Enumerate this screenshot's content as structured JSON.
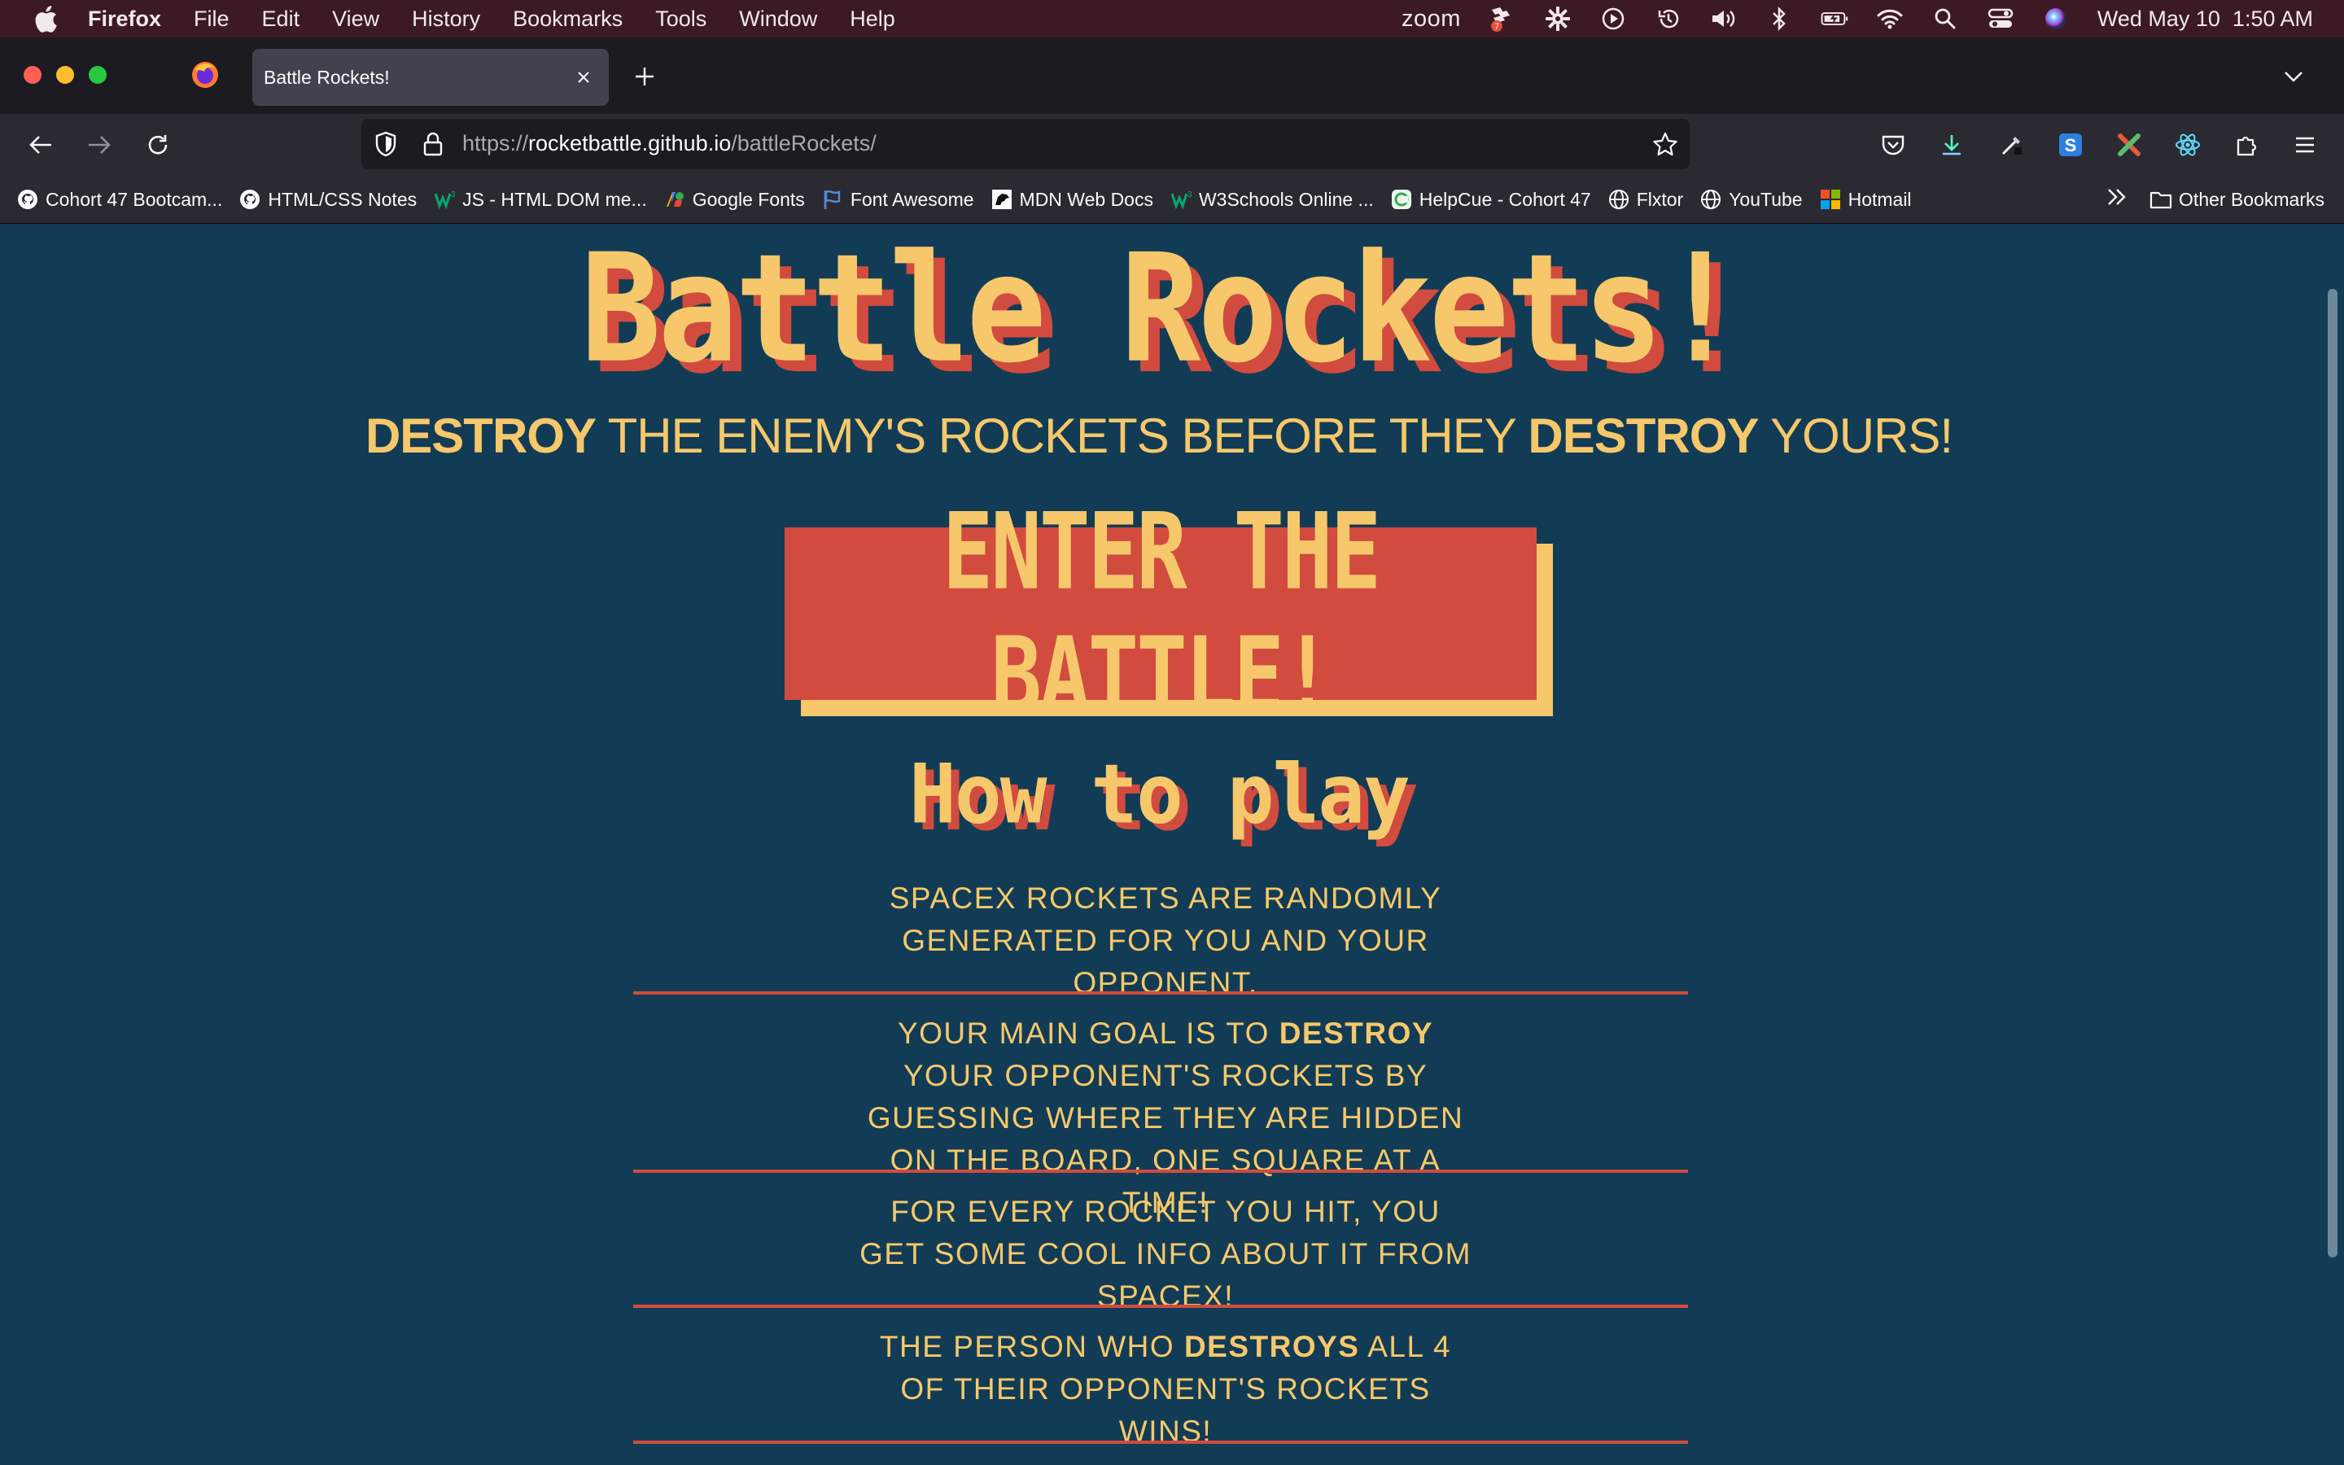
{
  "menubar": {
    "app_name": "Firefox",
    "menus": [
      "File",
      "Edit",
      "View",
      "History",
      "Bookmarks",
      "Tools",
      "Window",
      "Help"
    ],
    "zoom_label": "zoom",
    "badge_count": "7",
    "clock": "Wed May 10  1:50 AM",
    "status_icons": [
      "zoom",
      "flashcards-icon",
      "gear-icon",
      "play-icon",
      "time-machine-icon",
      "volume-icon",
      "bluetooth-icon",
      "battery-icon",
      "wifi-icon",
      "search-icon",
      "control-center-icon",
      "siri-icon"
    ]
  },
  "tab": {
    "title": "Battle Rockets!"
  },
  "url": {
    "scheme": "https://",
    "host": "rocketbattle.github.io",
    "path": "/battleRockets/"
  },
  "bookmarks": {
    "items": [
      "Cohort 47 Bootcam...",
      "HTML/CSS Notes",
      "JS - HTML DOM me...",
      "Google Fonts",
      "Font Awesome",
      "MDN Web Docs",
      "W3Schools Online ...",
      "HelpCue - Cohort 47",
      "Flxtor",
      "YouTube",
      "Hotmail"
    ],
    "other": "Other Bookmarks"
  },
  "page": {
    "title": "Battle Rockets!",
    "tagline": {
      "w1": "DESTROY",
      "t1": " THE ENEMY'S ROCKETS BEFORE THEY ",
      "w2": "DESTROY",
      "t2": " YOURS!"
    },
    "enter_button": "ENTER THE BATTLE!",
    "how_title": "How to play",
    "rules": [
      {
        "text": "SPACEX ROCKETS ARE RANDOMLY GENERATED FOR YOU AND YOUR OPPONENT."
      },
      {
        "before": "YOUR MAIN GOAL IS TO ",
        "bold": "DESTROY",
        "after": " YOUR OPPONENT'S ROCKETS BY GUESSING WHERE THEY ARE HIDDEN ON THE BOARD, ONE SQUARE AT A TIME!"
      },
      {
        "text": "FOR EVERY ROCKET YOU HIT, YOU GET SOME COOL INFO ABOUT IT FROM SPACEX!"
      },
      {
        "before": "THE PERSON WHO ",
        "bold": "DESTROYS",
        "after": " ALL 4 OF THEIR OPPONENT'S ROCKETS WINS!"
      }
    ]
  },
  "colors": {
    "page_bg": "#123c55",
    "accent_yellow": "#f6c86b",
    "accent_red": "#d24b3f"
  }
}
